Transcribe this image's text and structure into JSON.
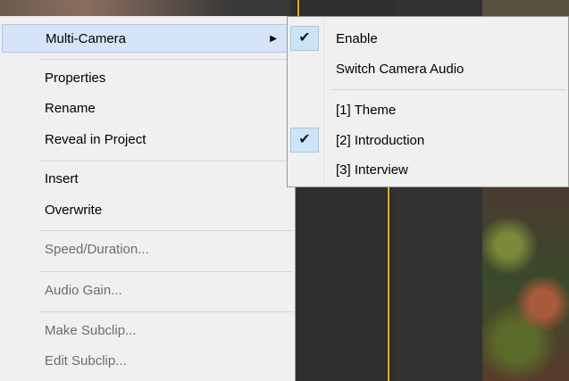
{
  "menu": {
    "items": [
      {
        "label": "Multi-Camera",
        "has_submenu": true,
        "highlighted": true,
        "enabled": true
      },
      {
        "label": "Properties",
        "enabled": true
      },
      {
        "label": "Rename",
        "enabled": true
      },
      {
        "label": "Reveal in Project",
        "enabled": true
      },
      {
        "label": "Insert",
        "enabled": true
      },
      {
        "label": "Overwrite",
        "enabled": true
      },
      {
        "label": "Speed/Duration...",
        "enabled": false
      },
      {
        "label": "Audio Gain...",
        "enabled": false
      },
      {
        "label": "Make Subclip...",
        "enabled": false
      },
      {
        "label": "Edit Subclip...",
        "enabled": false
      }
    ],
    "submenu_arrow": "▶"
  },
  "submenu": {
    "items": [
      {
        "label": "Enable",
        "checked": true
      },
      {
        "label": "Switch Camera Audio",
        "checked": false
      },
      {
        "label": "[1] Theme",
        "checked": false
      },
      {
        "label": "[2] Introduction",
        "checked": true
      },
      {
        "label": "[3] Interview",
        "checked": false
      }
    ],
    "check_glyph": "✔"
  },
  "colors": {
    "menu_bg": "#f0f0f0",
    "highlight": "#d5e5f7",
    "check_bg": "#cce4f7",
    "disabled_text": "#6d6d6d",
    "playhead": "#e0b000"
  }
}
